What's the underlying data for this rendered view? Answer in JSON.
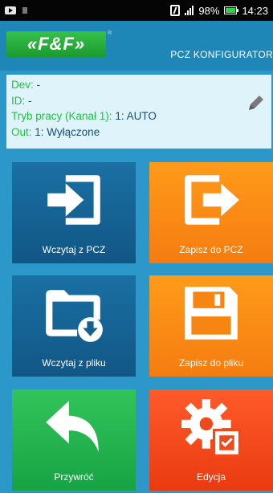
{
  "status_bar": {
    "battery": "98%",
    "time": "14:23"
  },
  "app_bar": {
    "logo_text": "«F&F»",
    "logo_reg": "®",
    "title": "PCZ KONFIGURATOR"
  },
  "device_info": {
    "dev_label": "Dev:",
    "dev_value": "-",
    "id_label": "ID:",
    "id_value": "-",
    "mode_label": "Tryb pracy (Kanał 1):",
    "mode_value": "1: AUTO",
    "out_label": "Out:",
    "out_value": "1: Wyłączone"
  },
  "tiles": [
    {
      "label": "Wczytaj z PCZ",
      "icon": "login-icon",
      "color": "#1a70a4"
    },
    {
      "label": "Zapisz do PCZ",
      "icon": "logout-icon",
      "color": "#f78a15"
    },
    {
      "label": "Wczytaj z pliku",
      "icon": "folder-download-icon",
      "color": "#1a70a4"
    },
    {
      "label": "Zapisz do pliku",
      "icon": "floppy-disk-icon",
      "color": "#f78a15"
    },
    {
      "label": "Przywróć",
      "icon": "undo-arrow-icon",
      "color": "#22b24d"
    },
    {
      "label": "Edycja",
      "icon": "settings-edit-icon",
      "color": "#f04a1c"
    }
  ]
}
